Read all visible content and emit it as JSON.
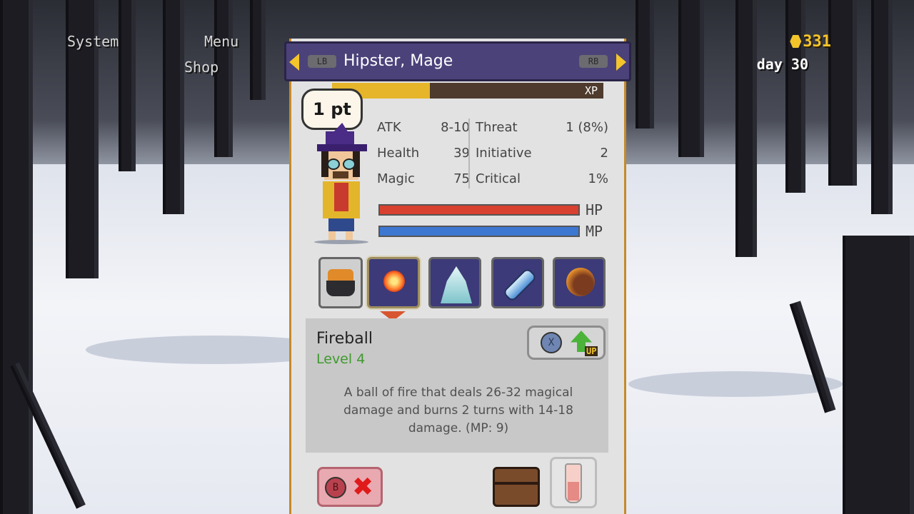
{
  "hud": {
    "system_label": "System",
    "menu_label": "Menu",
    "shop_label": "Shop",
    "gold": "331",
    "day": "day 30"
  },
  "character": {
    "title": "Hipster, Mage",
    "left_shoulder": "LB",
    "right_shoulder": "RB",
    "xp_label": "XP",
    "xp_fraction": 0.36,
    "points_label": "1 pt"
  },
  "stats": {
    "atk_label": "ATK",
    "atk_value": "8-10",
    "health_label": "Health",
    "health_value": "39",
    "magic_label": "Magic",
    "magic_value": "75",
    "threat_label": "Threat",
    "threat_value": "1 (8%)",
    "initiative_label": "Initiative",
    "initiative_value": "2",
    "critical_label": "Critical",
    "critical_value": "1%"
  },
  "bars": {
    "hp_label": "HP",
    "hp_fraction": 1.0,
    "hp_color": "#d8402f",
    "mp_label": "MP",
    "mp_fraction": 1.0,
    "mp_color": "#3c77d2"
  },
  "skills": [
    {
      "icon": "cauldron-icon",
      "selected": false
    },
    {
      "icon": "fireball-icon",
      "selected": true
    },
    {
      "icon": "ice-crystal-icon",
      "selected": false
    },
    {
      "icon": "ice-shard-icon",
      "selected": false
    },
    {
      "icon": "meteor-icon",
      "selected": false
    }
  ],
  "selected_skill": {
    "name": "Fireball",
    "level": "Level 4",
    "description_line1": "A ball of fire that deals 26-32 magical",
    "description_line2": "damage and burns 2 turns with 14-18",
    "description_line3": "damage. (MP: 9)",
    "upgrade_button_key": "X",
    "upgrade_tag": "UP"
  },
  "actions": {
    "cancel_key": "B",
    "cancel_symbol": "✖"
  },
  "colors": {
    "accent_gold": "#f3c52b",
    "title_bar": "#4b427a",
    "level_green": "#3e9a2d"
  }
}
